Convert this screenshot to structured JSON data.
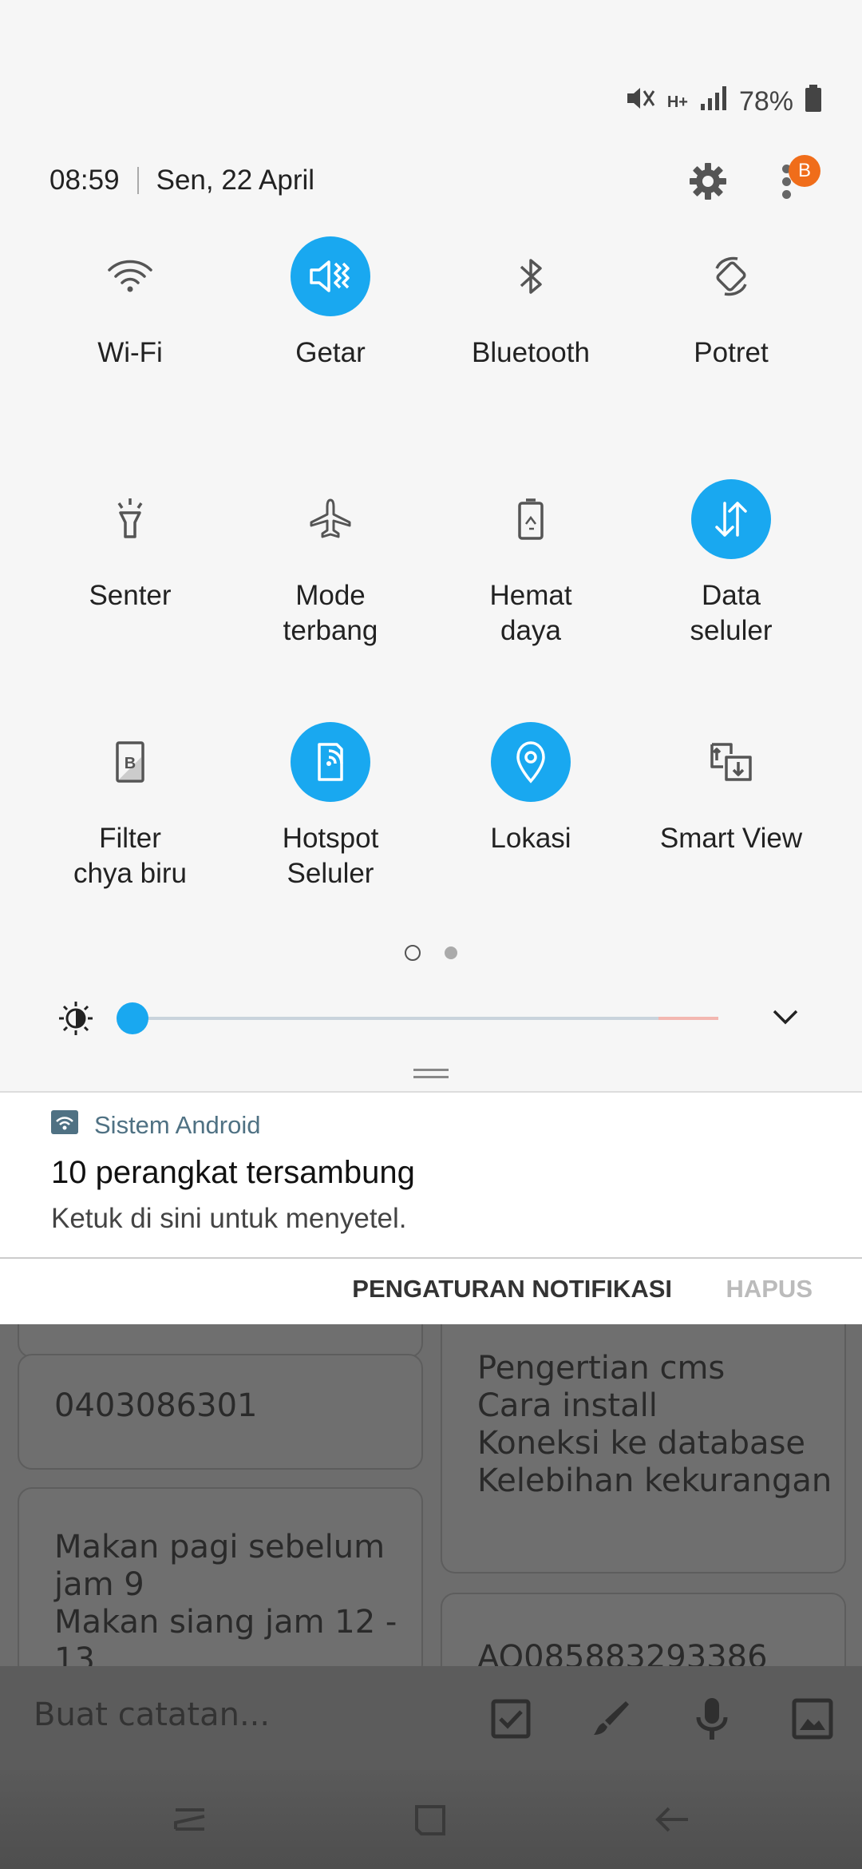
{
  "status_bar": {
    "battery": "78%",
    "network": "H+"
  },
  "header": {
    "time": "08:59",
    "date": "Sen, 22 April",
    "badge": "B"
  },
  "tiles": [
    {
      "label": "Wi-Fi",
      "icon": "wifi-icon",
      "active": false
    },
    {
      "label": "Getar",
      "icon": "vibrate-icon",
      "active": true
    },
    {
      "label": "Bluetooth",
      "icon": "bluetooth-icon",
      "active": false
    },
    {
      "label": "Potret",
      "icon": "rotate-icon",
      "active": false
    },
    {
      "label": "Senter",
      "icon": "flashlight-icon",
      "active": false
    },
    {
      "label": "Mode\nterbang",
      "icon": "airplane-icon",
      "active": false
    },
    {
      "label": "Hemat\ndaya",
      "icon": "battery-saver-icon",
      "active": false
    },
    {
      "label": "Data\nseluler",
      "icon": "mobile-data-icon",
      "active": true
    },
    {
      "label": "Filter\nchya biru",
      "icon": "blue-filter-icon",
      "active": false
    },
    {
      "label": "Hotspot\nSeluler",
      "icon": "hotspot-icon",
      "active": true
    },
    {
      "label": "Lokasi",
      "icon": "location-icon",
      "active": true
    },
    {
      "label": "Smart View",
      "icon": "smart-view-icon",
      "active": false
    }
  ],
  "brightness": {
    "level": 0.02
  },
  "notification": {
    "app": "Sistem Android",
    "title": "10 perangkat tersambung",
    "body": "Ketuk di sini untuk menyetel."
  },
  "actions": {
    "settings": "PENGATURAN NOTIFIKASI",
    "clear": "HAPUS"
  },
  "notes": {
    "left_top": "0403086301",
    "left_bottom": "Makan pagi sebelum\njam 9\nMakan siang jam 12 -\n13",
    "right_top": "Pengertian cms\nCara install\nKoneksi ke database\nKelebihan kekurangan",
    "right_bottom": "AQ085883293386"
  },
  "bottom_bar": {
    "placeholder": "Buat catatan..."
  },
  "colors": {
    "accent": "#19a8f0",
    "badge": "#f06d1a"
  }
}
